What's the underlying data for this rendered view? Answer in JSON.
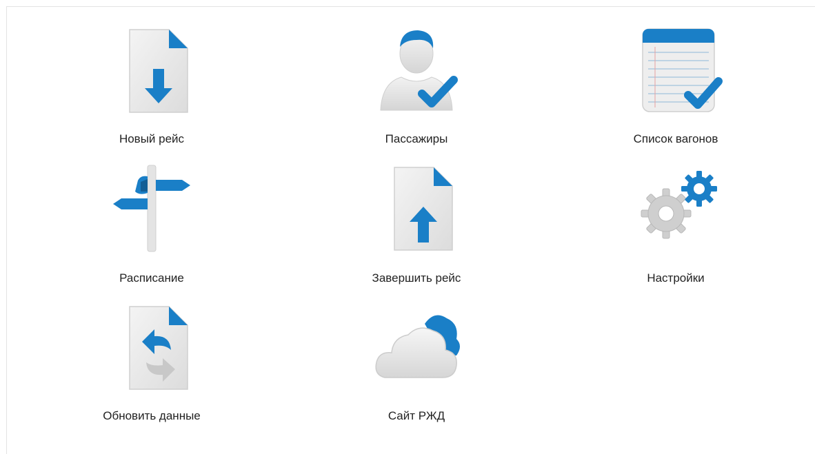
{
  "colors": {
    "accent": "#1a7fc7",
    "doc_fill": "#e8e8e8",
    "label_text": "#222222"
  },
  "tiles": [
    {
      "label": "Новый рейс",
      "icon": "file-download-icon"
    },
    {
      "label": "Пассажиры",
      "icon": "user-check-icon"
    },
    {
      "label": "Список вагонов",
      "icon": "notepad-check-icon"
    },
    {
      "label": "Расписание",
      "icon": "signpost-icon"
    },
    {
      "label": "Завершить рейс",
      "icon": "file-upload-icon"
    },
    {
      "label": "Настройки",
      "icon": "gears-icon"
    },
    {
      "label": "Обновить данные",
      "icon": "file-sync-icon"
    },
    {
      "label": "Сайт РЖД",
      "icon": "cloud-icon"
    }
  ]
}
